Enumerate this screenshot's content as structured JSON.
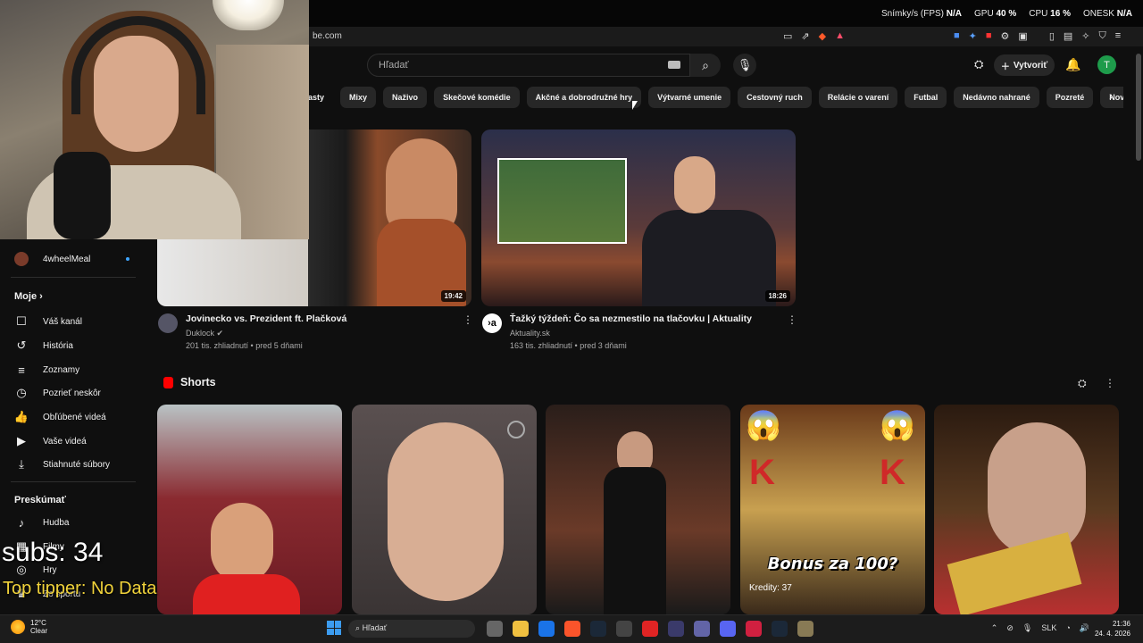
{
  "browser": {
    "url_fragment": "be.com",
    "perf": {
      "fps_label": "Snímky/s (FPS)",
      "fps_value": "N/A",
      "gpu_label": "GPU",
      "gpu_value": "40 %",
      "cpu_label": "CPU",
      "cpu_value": "16 %",
      "lag_label": "ONESK",
      "lag_value": "N/A"
    }
  },
  "header": {
    "search_placeholder": "Hľadať",
    "create_label": "Vytvoriť",
    "user_initial": "T"
  },
  "chips": [
    "casty",
    "Mixy",
    "Naživo",
    "Skečové komédie",
    "Akčné a dobrodružné hry",
    "Výtvarné umenie",
    "Cestovný ruch",
    "Relácie o varení",
    "Futbal",
    "Nedávno nahrané",
    "Pozreté",
    "Novinky pre vás"
  ],
  "sidebar": {
    "subscription": "4wheelMeal",
    "section_you": "Moje",
    "you_items": [
      "Váš kanál",
      "História",
      "Zoznamy",
      "Pozrieť neskôr",
      "Obľúbené videá",
      "Vaše videá",
      "Stiahnuté súbory"
    ],
    "section_explore": "Preskúmať",
    "explore_items": [
      "Hudba",
      "Filmy",
      "Hry",
      "Zo športu"
    ]
  },
  "videos": [
    {
      "title": "Jovinecko vs. Prezident ft. Plačková",
      "channel": "Duklock",
      "meta": "201 tis. zhliadnutí • pred 5 dňami",
      "duration": "19:42"
    },
    {
      "title": "Ťažký týždeň: Čo sa nezmestilo na tlačovku | Aktuality",
      "channel": "Aktuality.sk",
      "meta": "163 tis. zhliadnutí • pred 3 dňami",
      "duration": "18:26"
    }
  ],
  "shorts": {
    "heading": "Shorts",
    "overlay_text": "Bonus za 100?",
    "credits": "Kredity: 37"
  },
  "stream_overlay": {
    "subs": "subs: 34",
    "tipper": "Top tipper: No Data"
  },
  "taskbar": {
    "temp": "12°C",
    "weather": "Clear",
    "search": "Hľadať",
    "lang": "SLK",
    "time": "21:36",
    "date": "24. 4. 2026"
  }
}
